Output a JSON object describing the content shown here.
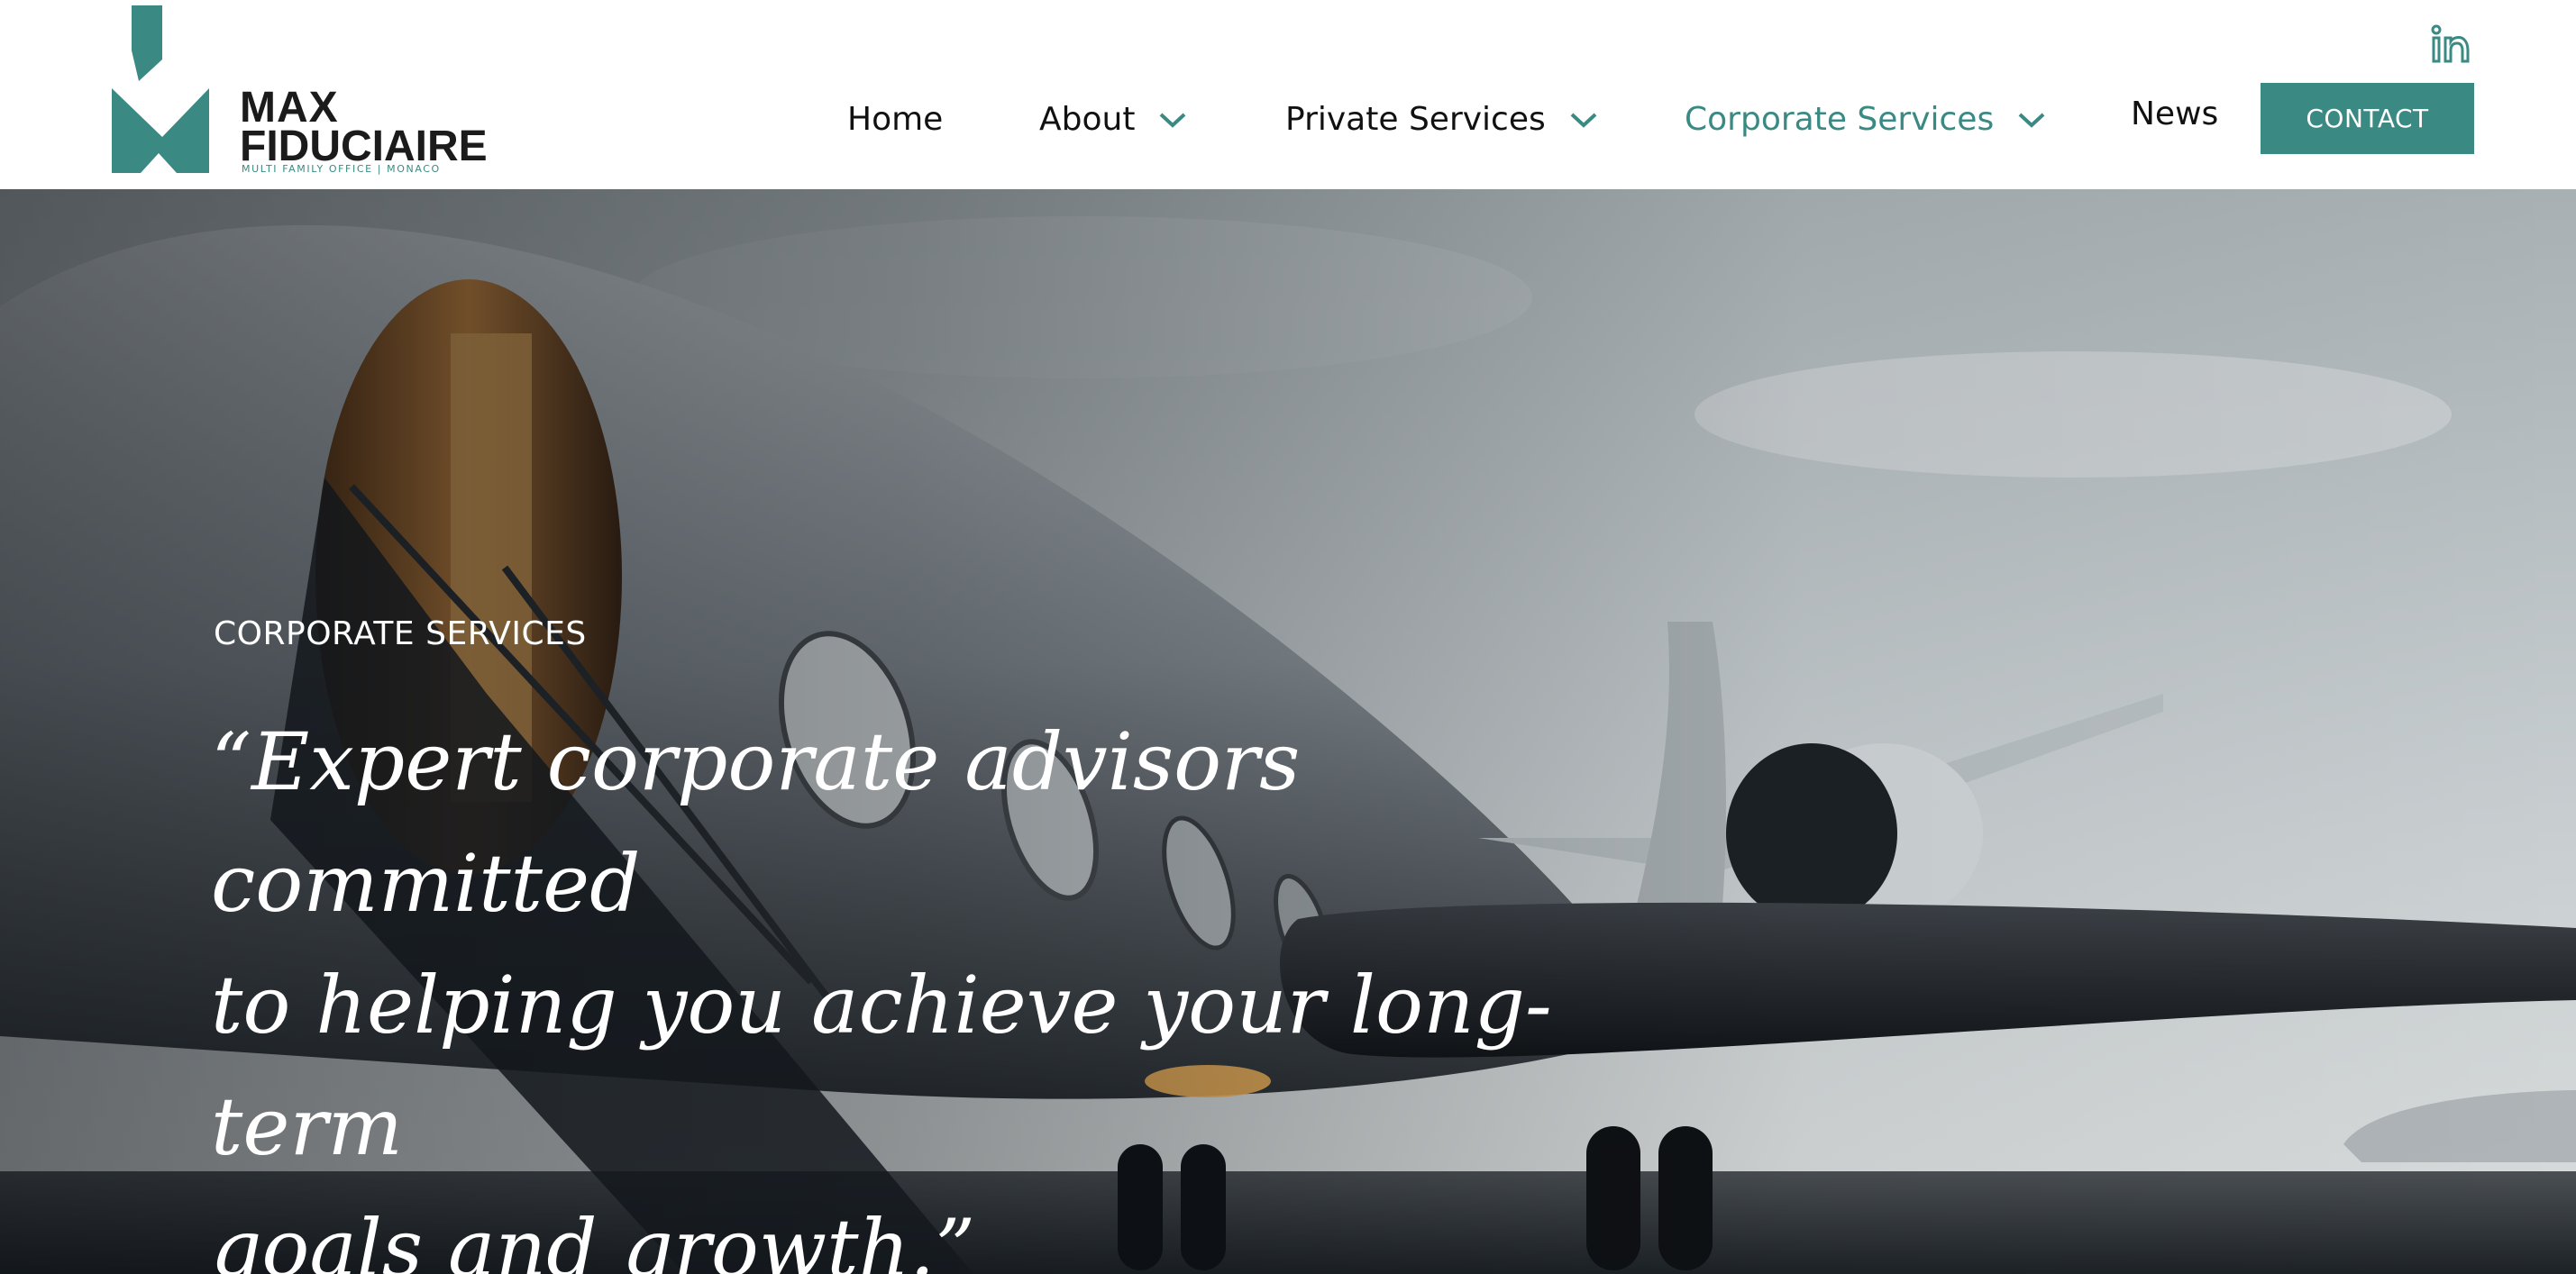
{
  "brand": {
    "name_line1": "MAX",
    "name_line2": "FIDUCIAIRE",
    "tagline": "MULTI FAMILY OFFICE | MONACO",
    "accent_color": "#3a8a83"
  },
  "nav": {
    "items": [
      {
        "label": "Home",
        "has_dropdown": false,
        "active": false
      },
      {
        "label": "About",
        "has_dropdown": true,
        "active": false
      },
      {
        "label": "Private Services",
        "has_dropdown": true,
        "active": false
      },
      {
        "label": "Corporate Services",
        "has_dropdown": true,
        "active": true
      },
      {
        "label": "News",
        "has_dropdown": false,
        "active": false
      }
    ],
    "contact_label": "CONTACT",
    "social_icon": "linkedin-icon"
  },
  "hero": {
    "eyebrow": "CORPORATE SERVICES",
    "quote_line1": "“Expert corporate advisors committed",
    "quote_line2": "to helping you achieve your long-term",
    "quote_line3": "goals and growth.”",
    "background": "private-jet-photo"
  }
}
